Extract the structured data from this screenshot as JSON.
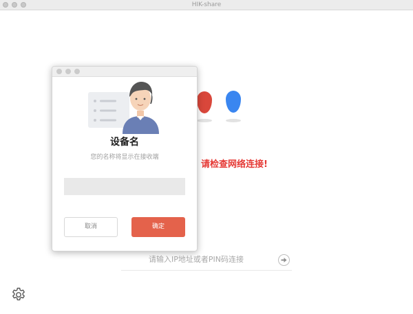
{
  "window": {
    "title": "HIK-share"
  },
  "main": {
    "network_message": "请检查网络连接!",
    "ip_input_placeholder": "请输入IP地址或者PIN码连接"
  },
  "dialog": {
    "title": "设备名",
    "subtitle": "您的名称将显示在接收端",
    "name_value": "",
    "cancel_label": "取消",
    "confirm_label": "确定"
  },
  "colors": {
    "accent": "#e4624b",
    "error_text": "#e53935",
    "pin_red": "#d9473b",
    "pin_blue": "#3a86f0",
    "avatar_shirt": "#6a7fb5",
    "avatar_hair": "#555555"
  },
  "icons": [
    "settings-gear-icon",
    "arrow-right-circle-icon",
    "location-pin-icon",
    "user-avatar-icon"
  ]
}
